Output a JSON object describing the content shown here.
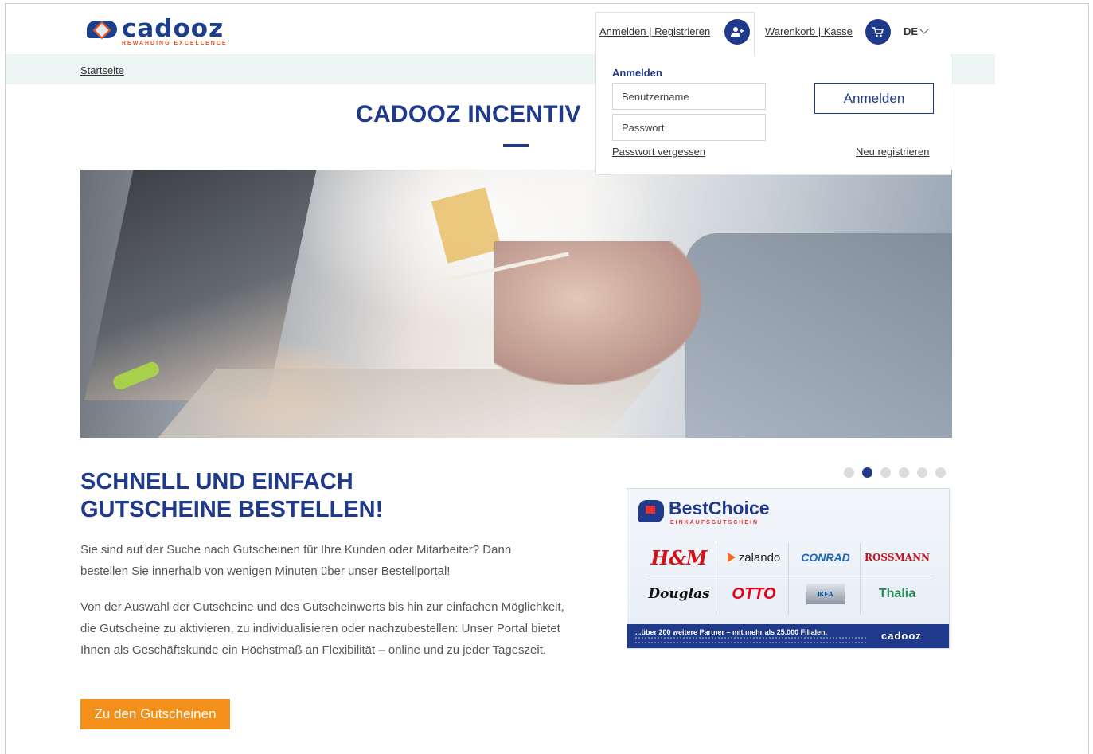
{
  "header": {
    "logo_text": "cadooz",
    "logo_tagline": "REWARDING EXCELLENCE",
    "login_link": "Anmelden | Registrieren",
    "cart_link": "Warenkorb | Kasse",
    "language": "DE"
  },
  "breadcrumb": {
    "home": "Startseite"
  },
  "page": {
    "title": "CADOOZ INCENTIV"
  },
  "login_popup": {
    "heading": "Anmelden",
    "username_placeholder": "Benutzername",
    "password_placeholder": "Passwort",
    "submit_label": "Anmelden",
    "forgot_link": "Passwort vergessen",
    "register_link": "Neu registrieren"
  },
  "content": {
    "heading_line1": "SCHNELL UND EINFACH",
    "heading_line2": "GUTSCHEINE BESTELLEN!",
    "paragraph1": "Sie sind auf der Suche nach Gutscheinen für Ihre Kunden oder Mitarbeiter? Dann bestellen Sie innerhalb von wenigen Minuten über unser Bestellportal!",
    "paragraph2": "Von der Auswahl der Gutscheine und des Gutscheinwerts bis hin zur einfachen Möglichkeit, die Gutscheine zu aktivieren, zu individualisieren oder nachzubestellen: Unser Portal bietet Ihnen als Geschäftskunde ein Höchstmaß an Flexibilität – online und zu jeder Tageszeit.",
    "cta_label": "Zu den Gutscheinen"
  },
  "carousel": {
    "slide_count": 6,
    "active_index": 1
  },
  "voucher_card": {
    "title": "BestChoice",
    "subtitle": "EINKAUFSGUTSCHEIN",
    "brands": [
      "H&M",
      "zalando",
      "CONRAD",
      "ROSSMANN",
      "Douglas",
      "OTTO",
      "IKEA",
      "Thalia"
    ],
    "footer_text": "...über 200 weitere Partner – mit mehr als 25.000 Filialen.",
    "footer_logo": "cadooz"
  },
  "colors": {
    "brand_blue": "#1f3a8a",
    "cta_orange": "#f3901c",
    "breadcrumb_bg": "#eef5f5"
  }
}
